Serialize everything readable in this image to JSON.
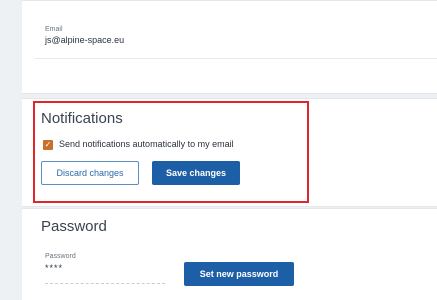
{
  "email_section": {
    "label": "Email",
    "value": "js@alpine-space.eu"
  },
  "notifications": {
    "title": "Notifications",
    "checkbox_label": "Send notifications automatically to my email",
    "checkbox_checked": true,
    "discard_label": "Discard changes",
    "save_label": "Save changes"
  },
  "password_section": {
    "title": "Password",
    "label": "Password",
    "value": "****",
    "set_password_label": "Set new password"
  },
  "colors": {
    "primary_button": "#1d5fa6",
    "checkbox_accent": "#c8702a",
    "highlight_border": "#e0262a"
  }
}
